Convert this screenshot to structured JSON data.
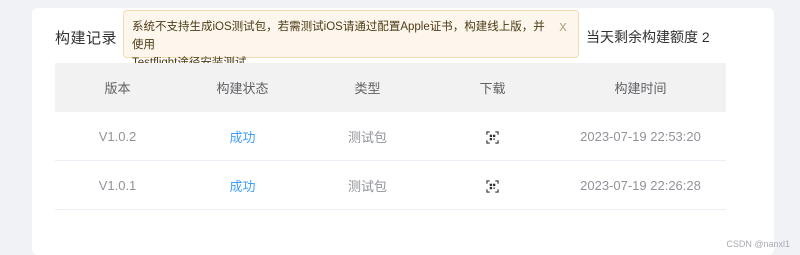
{
  "section": {
    "title": "构建记录",
    "quota_text": "当天剩余构建额度 2"
  },
  "alert": {
    "message_line1": "系统不支持生成iOS测试包，若需测试iOS请通过配置Apple证书，构建线上版，并使用",
    "message_line2": "Testflight途径安装测试。",
    "close_symbol": "x"
  },
  "table": {
    "headers": [
      "版本",
      "构建状态",
      "类型",
      "下载",
      "构建时间"
    ],
    "rows": [
      {
        "version": "V1.0.2",
        "status": "成功",
        "type": "测试包",
        "download_icon": "qr-code-icon",
        "time": "2023-07-19 22:53:20"
      },
      {
        "version": "V1.0.1",
        "status": "成功",
        "type": "测试包",
        "download_icon": "qr-code-icon",
        "time": "2023-07-19 22:26:28"
      }
    ]
  },
  "colors": {
    "link": "#409eff",
    "alert_bg": "#fdf6ec",
    "alert_border": "#f5dab1",
    "header_bg": "#f2f2f2"
  },
  "watermark": "CSDN @nanxl1"
}
